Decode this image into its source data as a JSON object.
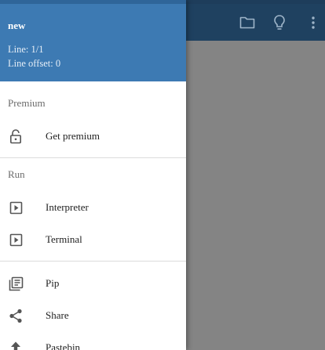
{
  "drawer": {
    "file_name": "new",
    "line": "Line: 1/1",
    "line_offset": "Line offset: 0",
    "sections": {
      "premium": {
        "title": "Premium",
        "items": [
          {
            "label": "Get premium",
            "icon": "lock-open-icon"
          }
        ]
      },
      "run": {
        "title": "Run",
        "items": [
          {
            "label": "Interpreter",
            "icon": "play-box-icon"
          },
          {
            "label": "Terminal",
            "icon": "play-box-icon"
          }
        ]
      },
      "other": {
        "items": [
          {
            "label": "Pip",
            "icon": "library-books-icon"
          },
          {
            "label": "Share",
            "icon": "share-icon"
          },
          {
            "label": "Pastebin",
            "icon": "upload-icon"
          }
        ]
      }
    }
  },
  "appbar": {
    "icons": [
      "folder-icon",
      "lightbulb-icon",
      "more-vert-icon"
    ]
  },
  "colors": {
    "drawer_header": "#3d7ab3",
    "appbar": "#1f4160",
    "scrim": "#858585",
    "icon": "#555555"
  }
}
